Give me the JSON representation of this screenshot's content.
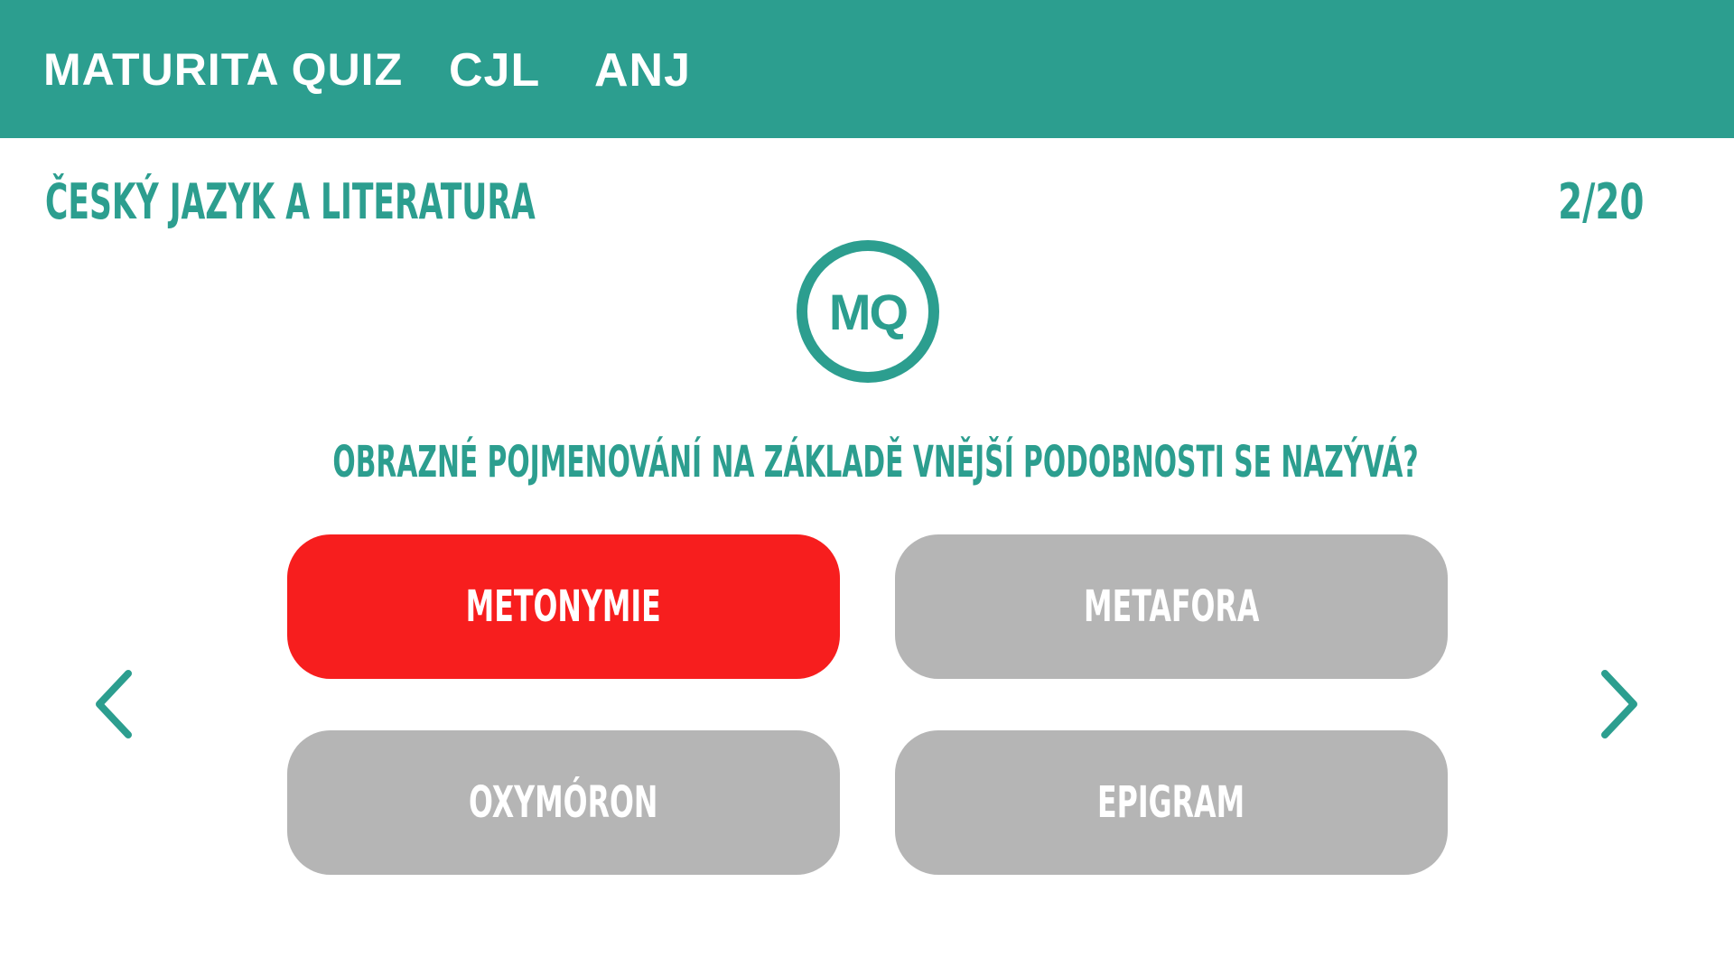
{
  "header": {
    "brand": "MATURITA QUIZ",
    "nav": [
      {
        "label": "CJL"
      },
      {
        "label": "ANJ"
      }
    ]
  },
  "quiz": {
    "subject": "ČESKÝ JAZYK A LITERATURA",
    "progress": "2/20",
    "logo_text": "MQ",
    "question": "OBRAZNÉ POJMENOVÁNÍ NA ZÁKLADĚ VNĚJŠÍ PODOBNOSTI SE NAZÝVÁ?",
    "answers": [
      {
        "label": "METONYMIE",
        "state": "wrong"
      },
      {
        "label": "METAFORA",
        "state": "neutral"
      },
      {
        "label": "OXYMÓRON",
        "state": "neutral"
      },
      {
        "label": "EPIGRAM",
        "state": "neutral"
      }
    ]
  },
  "icons": {
    "prev": "chevron-left-icon",
    "next": "chevron-right-icon"
  },
  "colors": {
    "accent": "#2c9e8f",
    "wrong": "#f71e1e",
    "neutral": "#b5b5b5"
  }
}
